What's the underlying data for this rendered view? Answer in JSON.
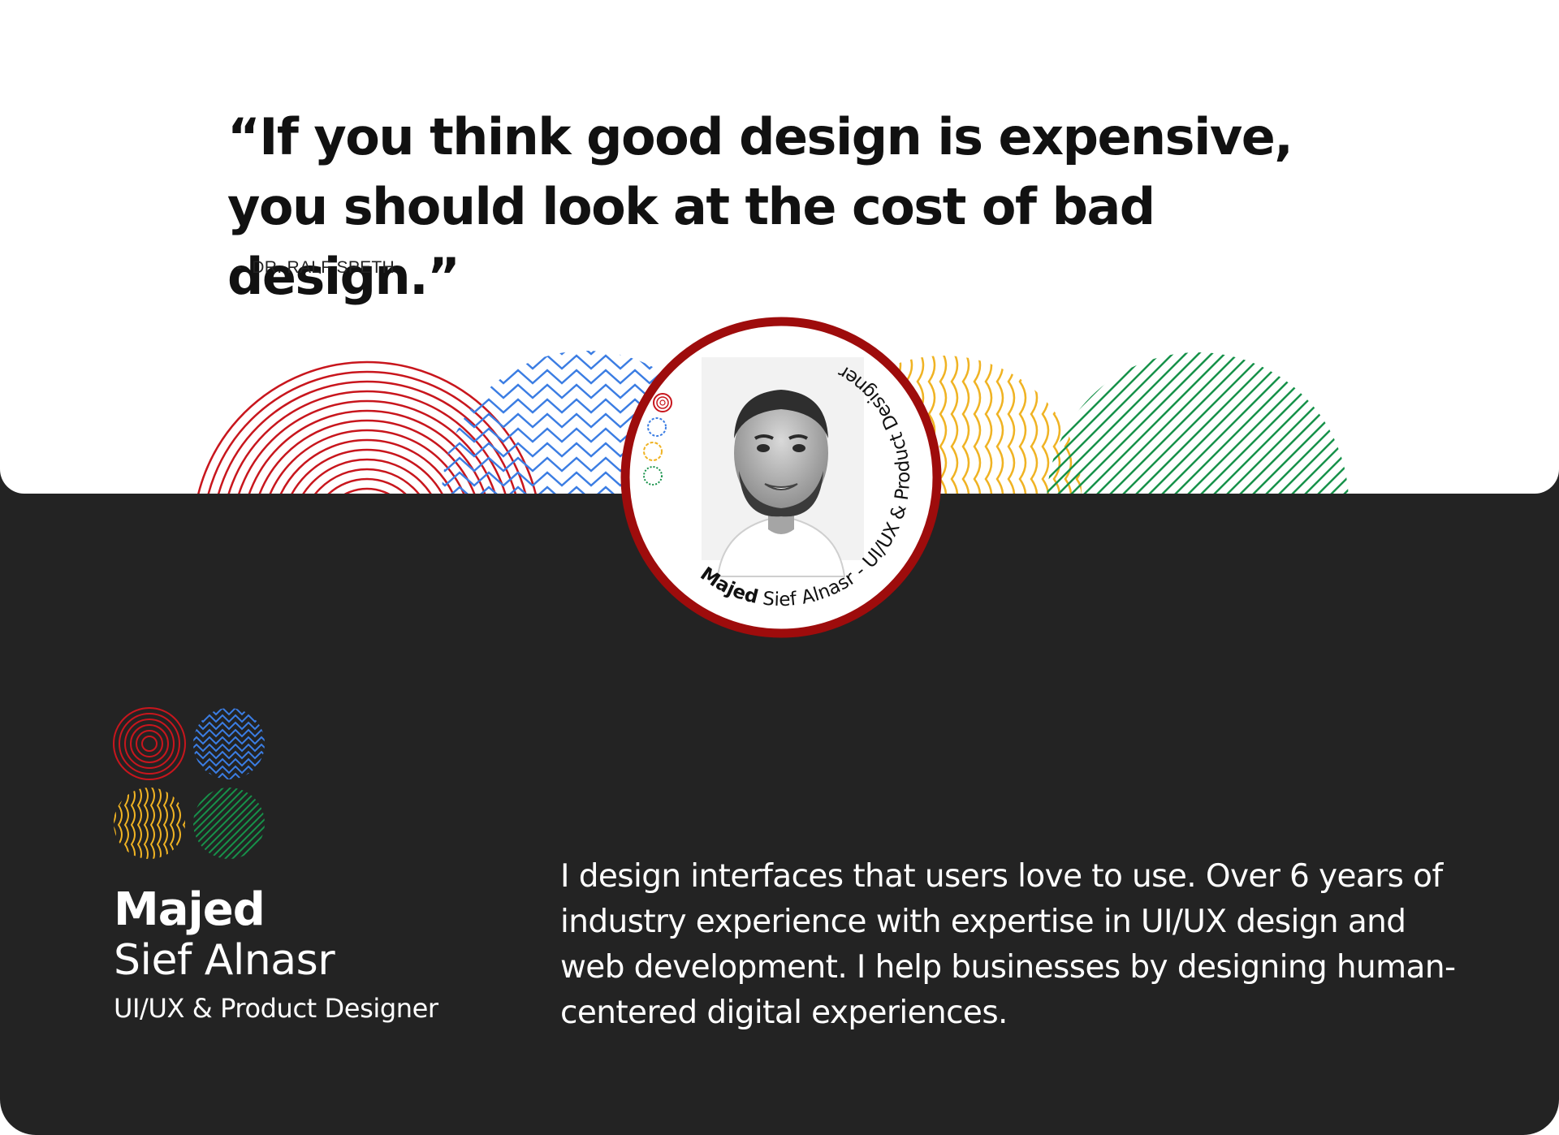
{
  "quote": {
    "text": "“If you think good design is expensive, you should look at the cost of bad design.”",
    "author": "DR. RALF SPETH",
    "dash": "-"
  },
  "profile": {
    "first_name": "Majed",
    "last_name": "Sief Alnasr",
    "role": "UI/UX & Product Designer",
    "separator": "-",
    "bio": "I design interfaces that users love to use. Over 6 years of industry experience with expertise in UI/UX design and web development. I help businesses by designing human-centered digital experiences."
  },
  "colors": {
    "red": "#c8161d",
    "blue": "#3b7de3",
    "yellow": "#f0b323",
    "green": "#17924a",
    "dark_background": "#232323",
    "badge_ring": "#9e0c0c"
  },
  "icons": {
    "pattern_1": "concentric-circles",
    "pattern_2": "chevron-stripes",
    "pattern_3": "wavy-lines",
    "pattern_4": "diagonal-lines"
  }
}
